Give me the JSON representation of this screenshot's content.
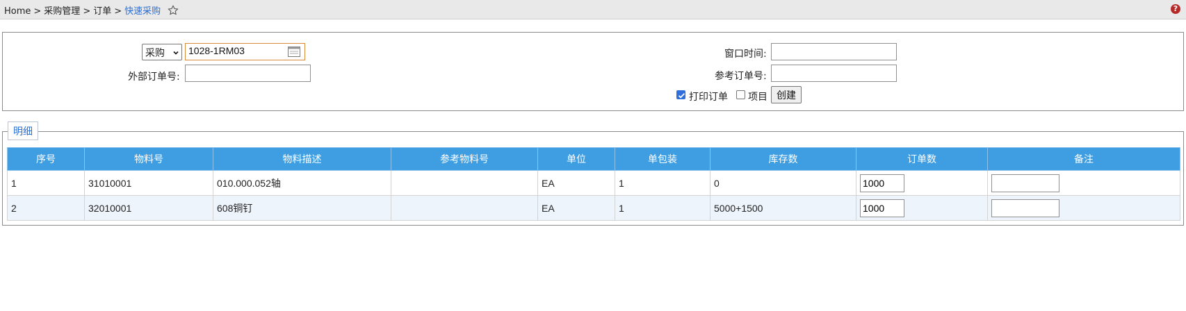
{
  "breadcrumb": {
    "items": [
      "Home",
      "采购管理",
      "订单",
      "快速采购"
    ],
    "separator": ">"
  },
  "form": {
    "type_select": {
      "value": "采购"
    },
    "order_code": {
      "value": "1028-1RM03"
    },
    "external_order_label": "外部订单号:",
    "external_order_value": "",
    "window_time_label": "窗口时间:",
    "window_time_value": "",
    "ref_order_label": "参考订单号:",
    "ref_order_value": "",
    "print_order_label": "打印订单",
    "print_order_checked": true,
    "project_label": "项目",
    "project_checked": false,
    "create_button_label": "创建"
  },
  "detail": {
    "legend": "明细",
    "columns": [
      "序号",
      "物料号",
      "物料描述",
      "参考物料号",
      "单位",
      "单包装",
      "库存数",
      "订单数",
      "备注"
    ],
    "rows": [
      {
        "seq": "1",
        "material_no": "31010001",
        "description": "010.000.052轴",
        "ref_material": "",
        "unit": "EA",
        "pack": "1",
        "stock": "0",
        "order_qty": "1000",
        "remark": ""
      },
      {
        "seq": "2",
        "material_no": "32010001",
        "description": "608铜钉",
        "ref_material": "",
        "unit": "EA",
        "pack": "1",
        "stock": "5000+1500",
        "order_qty": "1000",
        "remark": ""
      }
    ]
  },
  "colors": {
    "header_blue": "#3f9ee2",
    "link_blue": "#2a6fd6",
    "even_row": "#eef4fb"
  },
  "icons": [
    "star-icon",
    "help-icon",
    "calendar-icon",
    "chevron-down-icon",
    "checkmark-icon"
  ]
}
